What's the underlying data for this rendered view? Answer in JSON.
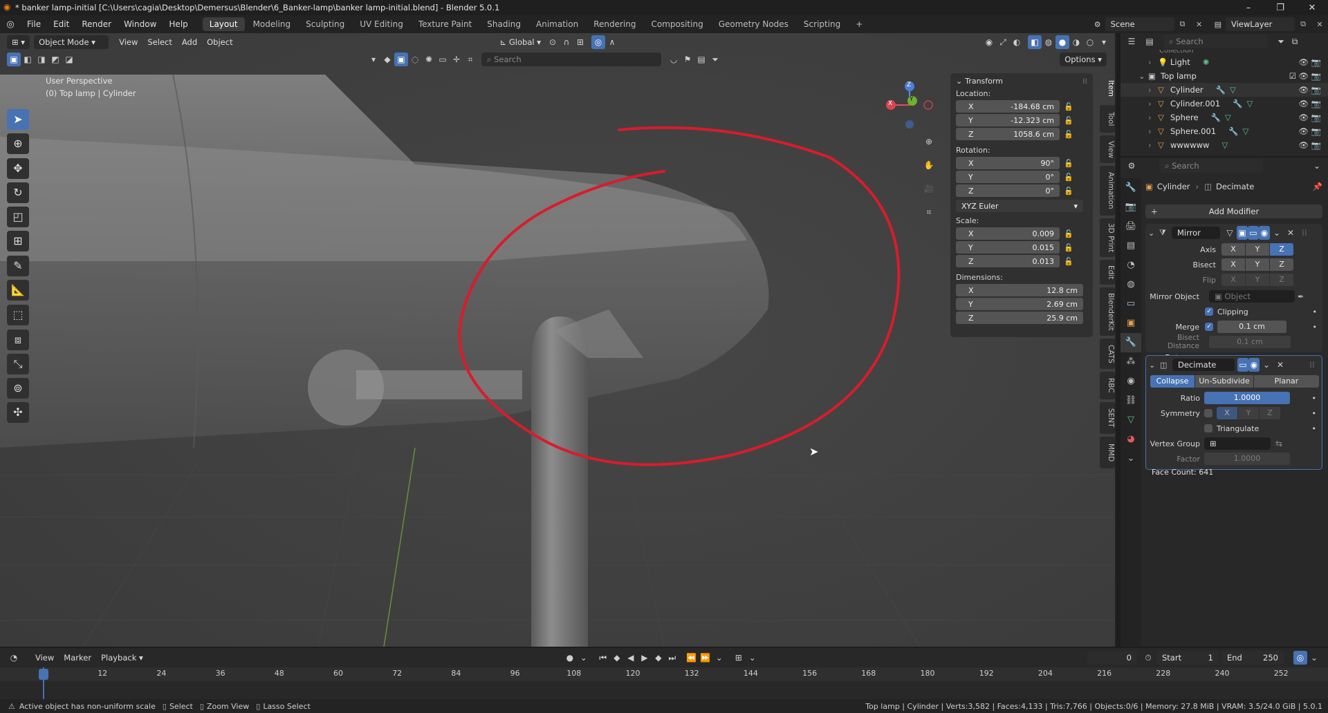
{
  "title_bar": {
    "title": "* banker lamp-initial [C:\\Users\\cagia\\Desktop\\Demersus\\Blender\\6_Banker-lamp\\banker lamp-initial.blend] - Blender 5.0.1",
    "minimize": "–",
    "maximize": "❐",
    "close": "✕"
  },
  "menu": {
    "items": [
      "File",
      "Edit",
      "Render",
      "Window",
      "Help"
    ],
    "workspaces": [
      "Layout",
      "Modeling",
      "Sculpting",
      "UV Editing",
      "Texture Paint",
      "Shading",
      "Animation",
      "Rendering",
      "Compositing",
      "Geometry Nodes",
      "Scripting"
    ],
    "active_workspace": "Layout",
    "add_tab": "+",
    "scene": "Scene",
    "view_layer": "ViewLayer"
  },
  "viewport": {
    "mode": "Object Mode",
    "menus": [
      "View",
      "Select",
      "Add",
      "Object"
    ],
    "orientation": "Global",
    "search_placeholder": "Search",
    "options_label": "Options",
    "overlay_title": "User Perspective",
    "overlay_subtitle": "(0) Top lamp | Cylinder",
    "gizmo": {
      "x": "X",
      "y": "Y",
      "z": "Z"
    },
    "annotation_color": "#d91c2a"
  },
  "toolbar": {
    "tools": [
      "select-box",
      "cursor",
      "move",
      "rotate",
      "scale",
      "transform",
      "annotate",
      "measure",
      "add-cube",
      "extrude",
      "knife",
      "shear",
      "spin"
    ]
  },
  "n_panel": {
    "header": "Transform",
    "location_label": "Location:",
    "location": [
      {
        "axis": "X",
        "value": "-184.68 cm"
      },
      {
        "axis": "Y",
        "value": "-12.323 cm"
      },
      {
        "axis": "Z",
        "value": "1058.6 cm"
      }
    ],
    "rotation_label": "Rotation:",
    "rotation": [
      {
        "axis": "X",
        "value": "90°"
      },
      {
        "axis": "Y",
        "value": "0°"
      },
      {
        "axis": "Z",
        "value": "0°"
      }
    ],
    "rotation_mode": "XYZ Euler",
    "scale_label": "Scale:",
    "scale": [
      {
        "axis": "X",
        "value": "0.009"
      },
      {
        "axis": "Y",
        "value": "0.015"
      },
      {
        "axis": "Z",
        "value": "0.013"
      }
    ],
    "dimensions_label": "Dimensions:",
    "dimensions": [
      {
        "axis": "X",
        "value": "12.8 cm"
      },
      {
        "axis": "Y",
        "value": "2.69 cm"
      },
      {
        "axis": "Z",
        "value": "25.9 cm"
      }
    ],
    "tabs": [
      "Item",
      "Tool",
      "View",
      "Animation",
      "3D Print",
      "Edit",
      "BlenderKit",
      "CATS",
      "RBC",
      "SENT",
      "MMD"
    ],
    "active_tab": "Item"
  },
  "outliner": {
    "search_placeholder": "Search",
    "partial_row": "Collection",
    "rows": [
      {
        "name": "Light",
        "indent": 1
      },
      {
        "name": "Top lamp",
        "indent": 0
      },
      {
        "name": "Cylinder",
        "indent": 2
      },
      {
        "name": "Cylinder.001",
        "indent": 2
      },
      {
        "name": "Sphere",
        "indent": 2
      },
      {
        "name": "Sphere.001",
        "indent": 2
      },
      {
        "name": "wwwwww",
        "indent": 2
      }
    ]
  },
  "properties": {
    "search_placeholder": "Search",
    "breadcrumb_object": "Cylinder",
    "breadcrumb_modifier": "Decimate",
    "add_modifier": "Add Modifier",
    "mirror": {
      "name": "Mirror",
      "axis_label": "Axis",
      "bisect_label": "Bisect",
      "flip_label": "Flip",
      "axes": [
        "X",
        "Y",
        "Z"
      ],
      "mirror_object_label": "Mirror Object",
      "mirror_object_placeholder": "Object",
      "clipping_label": "Clipping",
      "merge_label": "Merge",
      "merge_value": "0.1 cm",
      "bisect_distance_label": "Bisect Distance",
      "bisect_distance_value": "0.1 cm",
      "data_label": "Data"
    },
    "decimate": {
      "name": "Decimate",
      "modes": [
        "Collapse",
        "Un-Subdivide",
        "Planar"
      ],
      "active_mode": "Collapse",
      "ratio_label": "Ratio",
      "ratio_value": "1.0000",
      "symmetry_label": "Symmetry",
      "triangulate_label": "Triangulate",
      "vertex_group_label": "Vertex Group",
      "factor_label": "Factor",
      "factor_value": "1.0000",
      "face_count": "Face Count: 641"
    }
  },
  "timeline": {
    "menus": [
      "View",
      "Marker",
      "Playback"
    ],
    "current_frame": "0",
    "start_label": "Start",
    "start_value": "1",
    "end_label": "End",
    "end_value": "250",
    "ticks": [
      "0",
      "12",
      "24",
      "36",
      "48",
      "60",
      "72",
      "84",
      "96",
      "108",
      "120",
      "132",
      "144",
      "156",
      "168",
      "180",
      "192",
      "204",
      "216",
      "228",
      "240",
      "252"
    ]
  },
  "status_bar": {
    "warning": "Active object has non-uniform scale",
    "select": "Select",
    "zoom_view": "Zoom View",
    "lasso_select": "Lasso Select",
    "stats": "Top lamp | Cylinder | Verts:3,582 | Faces:4,133 | Tris:7,766 | Objects:0/6 | Memory: 27.8 MiB | VRAM: 3.5/24.0 GiB | 5.0.1"
  }
}
